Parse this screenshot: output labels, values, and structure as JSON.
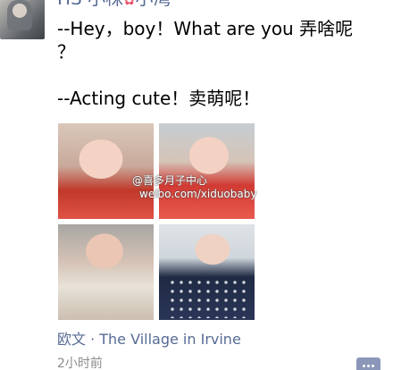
{
  "post": {
    "username": "HS 小枺",
    "username_suffix": "小湾",
    "username_emoji": "✿",
    "text_line1": "--Hey，boy！What are you 弄啥呢",
    "text_line2": "？",
    "text_line3": "--Acting cute！卖萌呢！",
    "watermark_line1": "@喜多月子中心",
    "watermark_line2": "weibo.com/xiduobaby",
    "location": "欧文 · The Village in Irvine",
    "timestamp": "2小时前"
  },
  "colors": {
    "link": "#576b95",
    "timestamp": "#8c8c8c",
    "comment_button": "#8a97b8"
  },
  "icons": {
    "comment": "comment-icon",
    "weibo": "weibo-logo-icon"
  }
}
